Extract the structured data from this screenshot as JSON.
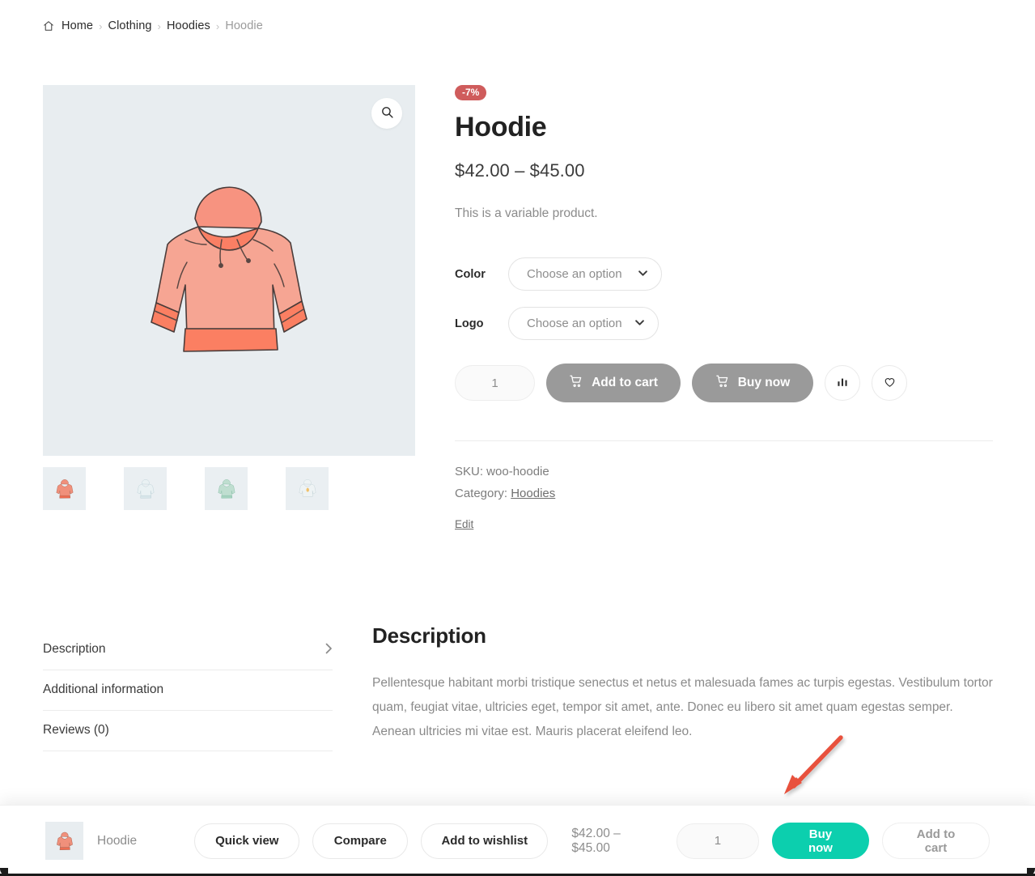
{
  "breadcrumb": {
    "home_icon": "home-icon",
    "items": [
      {
        "label": "Home",
        "current": false
      },
      {
        "label": "Clothing",
        "current": false
      },
      {
        "label": "Hoodies",
        "current": false
      },
      {
        "label": "Hoodie",
        "current": true
      }
    ],
    "separator": "›"
  },
  "gallery": {
    "zoom_icon": "search-icon",
    "main_alt": "Hoodie",
    "background_color": "#e8edf0",
    "thumbnails": [
      {
        "name": "thumb-hoodie-red",
        "color": "#f0907b",
        "accent": "#ee6d52",
        "active": true
      },
      {
        "name": "thumb-hoodie-blue",
        "color": "#dde7ea",
        "accent": "#c9d7dc",
        "active": false
      },
      {
        "name": "thumb-hoodie-green",
        "color": "#b6ddcc",
        "accent": "#8fc9b3",
        "active": false
      },
      {
        "name": "thumb-hoodie-logo",
        "color": "#e6edee",
        "accent": "#f0c06a",
        "active": false
      }
    ]
  },
  "summary": {
    "sale_badge": "-7%",
    "sale_badge_color": "#cf5c5c",
    "title": "Hoodie",
    "price": "$42.00 – $45.00",
    "short_description": "This is a variable product.",
    "variations": [
      {
        "label": "Color",
        "value": "Choose an option",
        "width": 190
      },
      {
        "label": "Logo",
        "value": "Choose an option",
        "width": 186
      }
    ],
    "quantity": "1",
    "add_to_cart_label": "Add to cart",
    "buy_now_label": "Buy now",
    "cart_icon": "cart-icon",
    "compare_icon": "compare-bars-icon",
    "wishlist_icon": "heart-icon",
    "disabled_button_color": "#9a9a9a",
    "sku_line": "SKU: woo-hoodie",
    "category_prefix": "Category:",
    "category_link": "Hoodies",
    "edit_label": "Edit"
  },
  "tabs": [
    {
      "label": "Description",
      "active": true,
      "chevron": "›"
    },
    {
      "label": "Additional information",
      "active": false,
      "chevron": ""
    },
    {
      "label": "Reviews (0)",
      "active": false,
      "chevron": ""
    }
  ],
  "description_panel": {
    "heading": "Description",
    "body": "Pellentesque habitant morbi tristique senectus et netus et malesuada fames ac turpis egestas. Vestibulum tortor quam, feugiat vitae, ultricies eget, tempor sit amet, ante. Donec eu libero sit amet quam egestas semper. Aenean ultricies mi vitae est. Mauris placerat eleifend leo."
  },
  "annotation": {
    "arrow_color": "#e8513c",
    "direction": "down-left"
  },
  "sticky_bar": {
    "product_name": "Hoodie",
    "thumb_name": "sticky-product-thumbnail",
    "quick_view_label": "Quick view",
    "compare_label": "Compare",
    "wishlist_label": "Add to wishlist",
    "price": "$42.00 – $45.00",
    "quantity": "1",
    "buy_now_label": "Buy now",
    "buy_now_color": "#0ccfae",
    "add_to_cart_label": "Add to cart"
  }
}
